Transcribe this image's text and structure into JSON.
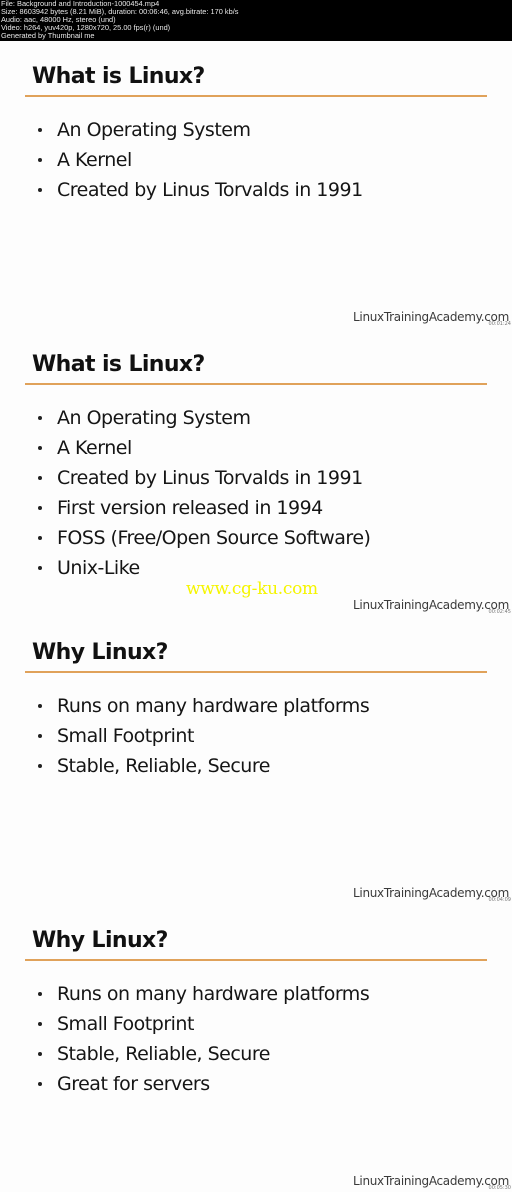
{
  "header": {
    "lines": [
      "File: Background and Introduction-1000454.mp4",
      "Size: 8603942 bytes (8.21 MiB), duration: 00:06:46, avg.bitrate: 170 kb/s",
      "Audio: aac, 48000 Hz, stereo (und)",
      "Video: h264, yuv420p, 1280x720, 25.00 fps(r) (und)",
      "Generated by Thumbnail me"
    ]
  },
  "colors": {
    "title_rule": "#e0a25a",
    "watermark": "#f5f500",
    "header_bg": "#000000"
  },
  "slides": [
    {
      "title": "What is Linux?",
      "bullets": [
        "An Operating System",
        "A Kernel",
        "Created by Linus Torvalds in 1991"
      ],
      "footer": "LinuxTrainingAcademy.com",
      "timestamp": "00:01:24"
    },
    {
      "title": "What is Linux?",
      "bullets": [
        "An Operating System",
        "A Kernel",
        "Created by Linus Torvalds in 1991",
        "First version released in 1994",
        "FOSS (Free/Open Source Software)",
        "Unix-Like"
      ],
      "footer": "LinuxTrainingAcademy.com",
      "timestamp": "00:02:45",
      "watermark": "www.cg-ku.com"
    },
    {
      "title": "Why Linux?",
      "bullets": [
        "Runs on many hardware platforms",
        "Small Footprint",
        "Stable, Reliable, Secure"
      ],
      "footer": "LinuxTrainingAcademy.com",
      "timestamp": "00:04:09"
    },
    {
      "title": "Why Linux?",
      "bullets": [
        "Runs on many hardware platforms",
        "Small Footprint",
        "Stable, Reliable, Secure",
        "Great for servers"
      ],
      "footer": "LinuxTrainingAcademy.com",
      "timestamp": "00:05:30"
    }
  ]
}
